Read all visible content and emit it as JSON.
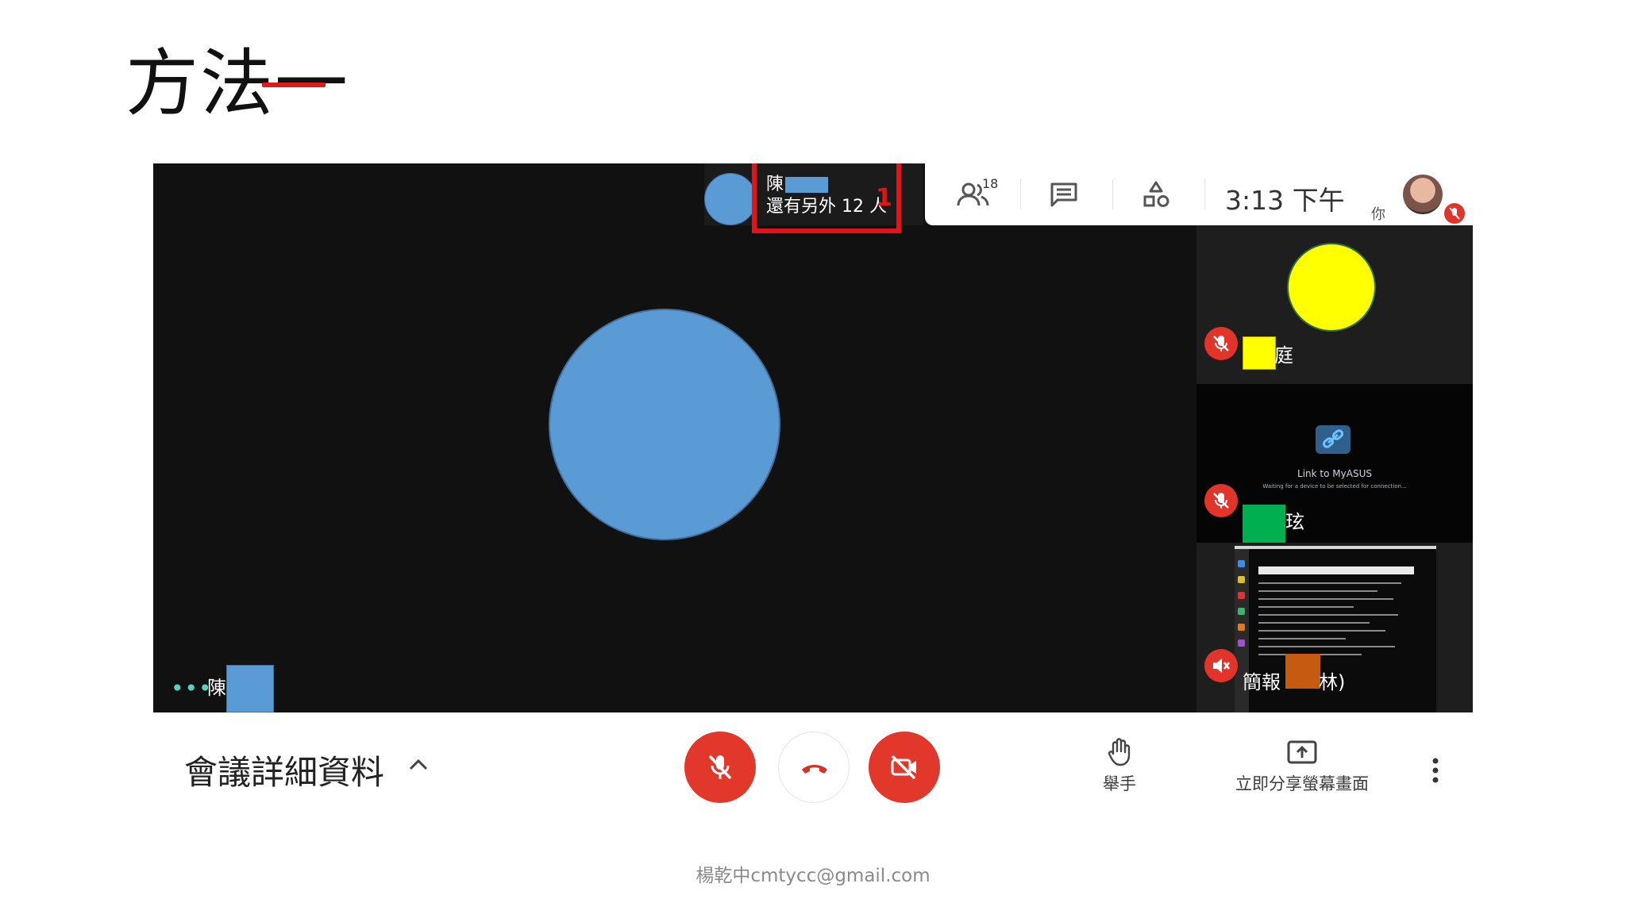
{
  "slide": {
    "title": "方法一",
    "footer": "楊乾中cmtycc@gmail.com",
    "accent_color": "#e0191b"
  },
  "meet": {
    "top_participant": {
      "name": "陳",
      "others_label": "還有另外 12 人",
      "annotation_number": "1"
    },
    "toolbar": {
      "people_icon": "people-icon",
      "people_count": "18",
      "chat_icon": "chat-icon",
      "activities_icon": "activities-icon",
      "clock": "3:13 下午",
      "self_label": "你"
    },
    "main_tile": {
      "dots": "•••",
      "name": "陳"
    },
    "side_tiles": [
      {
        "name": "庭",
        "mic": "muted"
      },
      {
        "name": "玹",
        "mic": "muted",
        "screen_title": "Link to MyASUS",
        "screen_subtitle": "Waiting for a device to be selected for connection..."
      },
      {
        "name_prefix": "簡報",
        "name_suffix": "林)",
        "mic": "muted"
      }
    ],
    "bottom": {
      "details_label": "會議詳細資料",
      "raise_hand_label": "舉手",
      "present_label": "立即分享螢幕畫面"
    },
    "colors": {
      "danger": "#e2382b",
      "avatar_blue": "#5b9bd5",
      "avatar_yellow": "#ffff00",
      "mask_green": "#00b050",
      "mask_orange": "#c55a11"
    }
  }
}
